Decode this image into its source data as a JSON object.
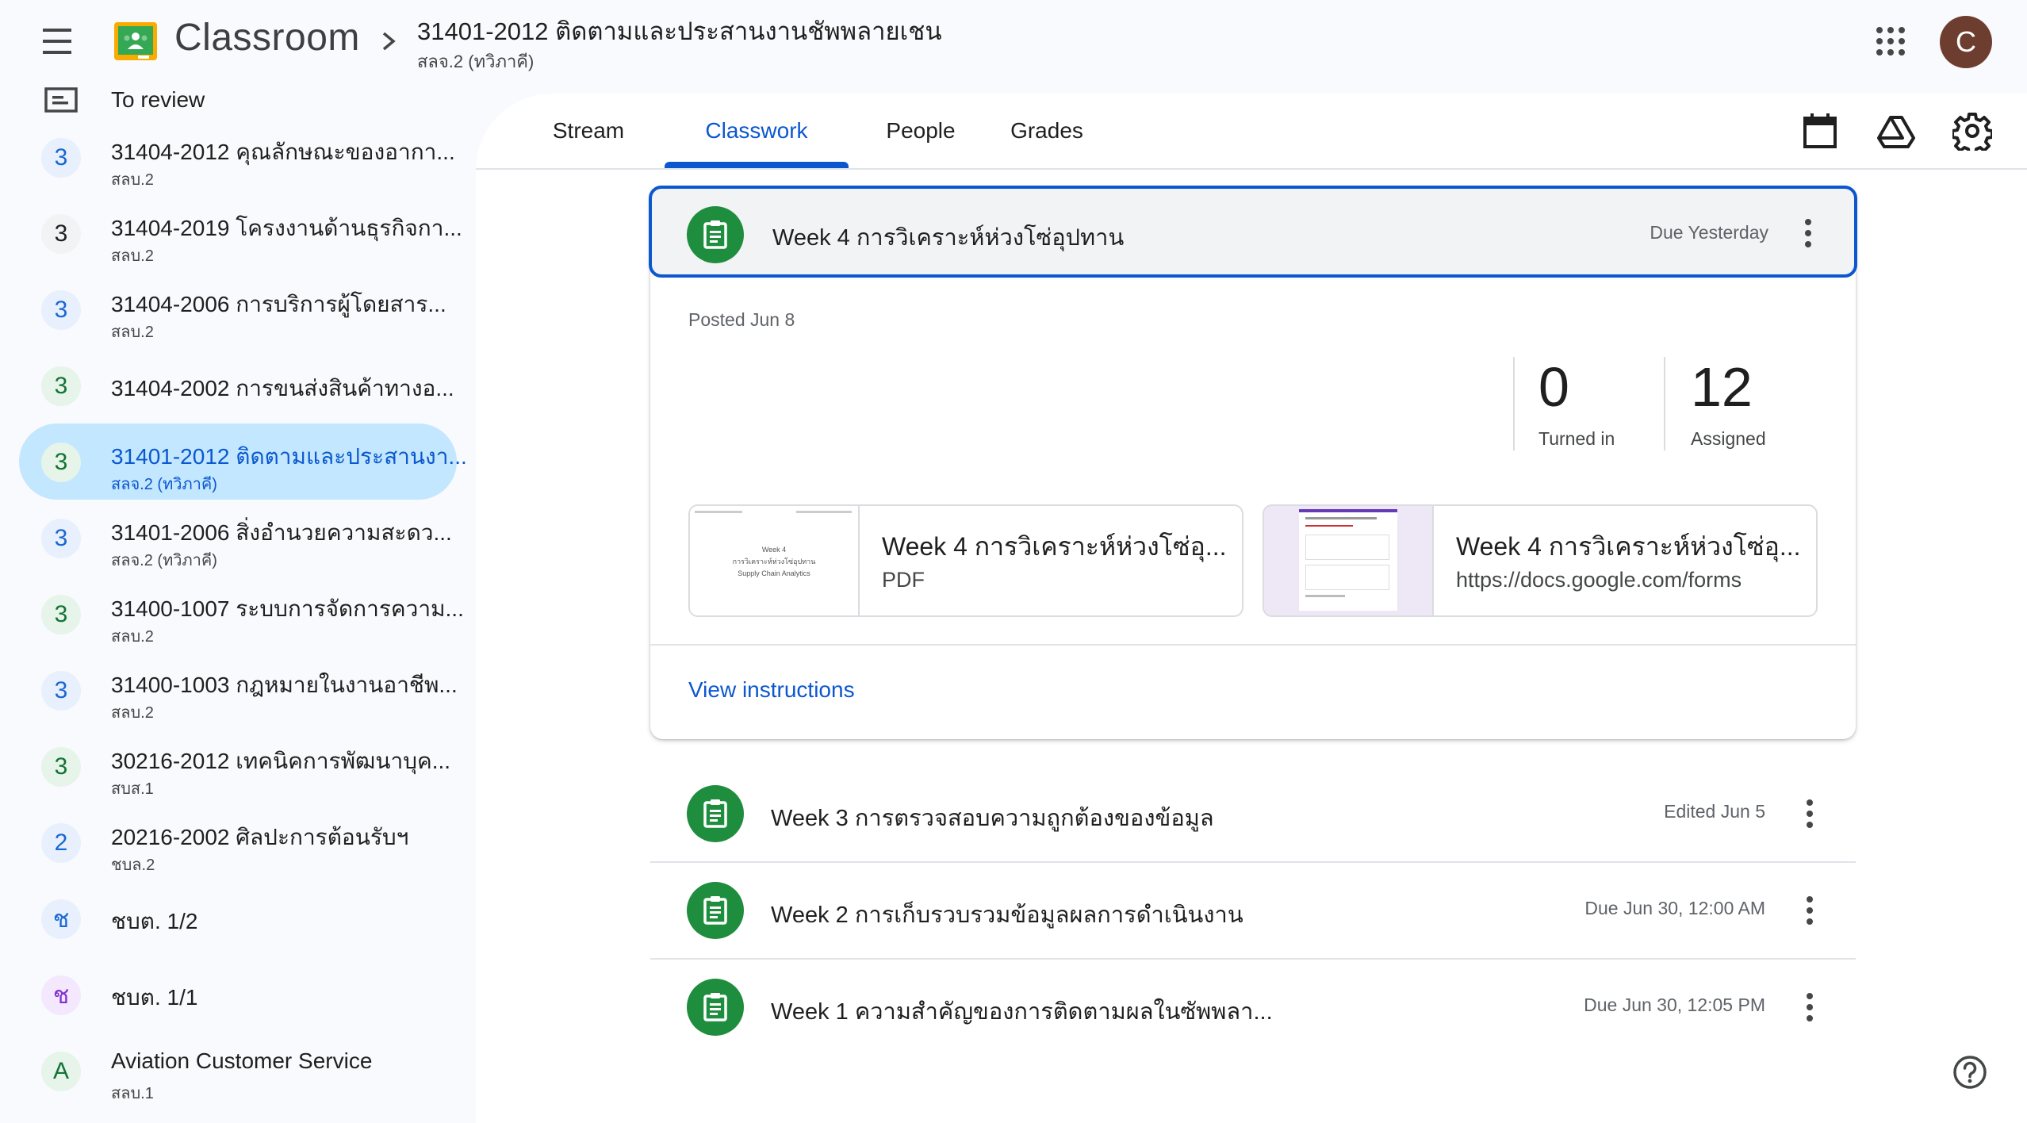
{
  "header": {
    "app_title": "Classroom",
    "course_title": "31401-2012 ติดตามและประสานงานชัพพลายเชน",
    "course_subtitle": "สลจ.2 (ทวิภาคี)",
    "avatar_letter": "C"
  },
  "sidebar": {
    "to_review": "To review",
    "items": [
      {
        "badge": "3",
        "title": "31404-2012 คุณลักษณะของอากา...",
        "subtitle": "สลบ.2",
        "badge_bg": "#e8f0fe",
        "badge_fg": "#1967d2"
      },
      {
        "badge": "3",
        "title": "31404-2019 โครงงานด้านธุรกิจกา...",
        "subtitle": "สลบ.2",
        "badge_bg": "#f1f3f4",
        "badge_fg": "#202124"
      },
      {
        "badge": "3",
        "title": "31404-2006 การบริการผู้โดยสาร...",
        "subtitle": "สลบ.2",
        "badge_bg": "#e8f0fe",
        "badge_fg": "#1967d2"
      },
      {
        "badge": "3",
        "title": "31404-2002 การขนส่งสินค้าทางอ...",
        "subtitle": "",
        "badge_bg": "#e6f4ea",
        "badge_fg": "#137333"
      },
      {
        "badge": "3",
        "title": "31401-2012 ติดตามและประสานงา...",
        "subtitle": "สลจ.2 (ทวิภาคี)",
        "badge_bg": "#e6f4ea",
        "badge_fg": "#137333",
        "active": true
      },
      {
        "badge": "3",
        "title": "31401-2006 สิ่งอำนวยความสะดว...",
        "subtitle": "สลจ.2 (ทวิภาคี)",
        "badge_bg": "#e8f0fe",
        "badge_fg": "#1967d2"
      },
      {
        "badge": "3",
        "title": "31400-1007 ระบบการจัดการความ...",
        "subtitle": "สลบ.2",
        "badge_bg": "#e6f4ea",
        "badge_fg": "#137333"
      },
      {
        "badge": "3",
        "title": "31400-1003 กฎหมายในงานอาชีพ...",
        "subtitle": "สลบ.2",
        "badge_bg": "#e8f0fe",
        "badge_fg": "#1967d2"
      },
      {
        "badge": "3",
        "title": "30216-2012 เทคนิคการพัฒนาบุค...",
        "subtitle": "สบส.1",
        "badge_bg": "#e6f4ea",
        "badge_fg": "#137333"
      },
      {
        "badge": "2",
        "title": "20216-2002 ศิลปะการต้อนรับฯ",
        "subtitle": "ชบล.2",
        "badge_bg": "#e8f0fe",
        "badge_fg": "#1967d2"
      },
      {
        "badge": "ช",
        "title": "ชบต. 1/2",
        "subtitle": "",
        "badge_bg": "#e8f0fe",
        "badge_fg": "#1967d2"
      },
      {
        "badge": "ช",
        "title": "ชบต. 1/1",
        "subtitle": "",
        "badge_bg": "#f3e8fd",
        "badge_fg": "#8430ce"
      },
      {
        "badge": "A",
        "title": "Aviation Customer Service",
        "subtitle": "สลบ.1",
        "badge_bg": "#e6f4ea",
        "badge_fg": "#137333"
      }
    ]
  },
  "tabs": [
    {
      "label": "Stream"
    },
    {
      "label": "Classwork",
      "active": true
    },
    {
      "label": "People"
    },
    {
      "label": "Grades"
    }
  ],
  "toolbar_icons": [
    "calendar-icon",
    "drive-icon",
    "settings-icon"
  ],
  "expanded": {
    "title": "Week 4 การวิเคราะห์ห่วงโซ่อุปทาน",
    "due": "Due Yesterday",
    "posted": "Posted Jun 8",
    "turned_in_count": "0",
    "turned_in_label": "Turned in",
    "assigned_count": "12",
    "assigned_label": "Assigned",
    "attachments": [
      {
        "title": "Week 4 การวิเคราะห์ห่วงโซ่อุ...",
        "subtitle": "PDF",
        "thumb_lines": [
          "Week 4",
          "การวิเคราะห์ห่วงโซ่อุปทาน",
          "Supply Chain Analytics"
        ]
      },
      {
        "title": "Week 4 การวิเคราะห์ห่วงโซ่อุ...",
        "subtitle": "https://docs.google.com/forms"
      }
    ],
    "view_instructions": "View instructions"
  },
  "assignments": [
    {
      "title": "Week 3 การตรวจสอบความถูกต้องของข้อมูล",
      "meta": "Edited Jun 5"
    },
    {
      "title": "Week 2 การเก็บรวบรวมข้อมูลผลการดำเนินงาน",
      "meta": "Due Jun 30, 12:00 AM"
    },
    {
      "title": "Week 1 ความสำคัญของการติดตามผลในซัพพลา...",
      "meta": "Due Jun 30, 12:05 PM"
    }
  ],
  "colors": {
    "accent": "#0b57d0",
    "assignment_icon": "#1e8e3e",
    "active_nav": "#c2e7ff"
  }
}
